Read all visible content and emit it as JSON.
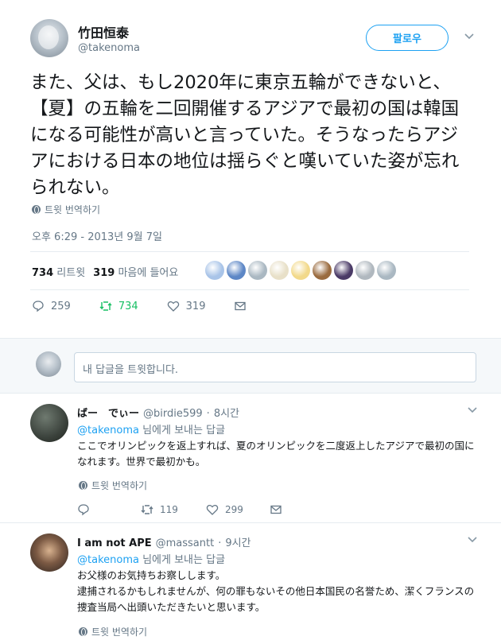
{
  "main_tweet": {
    "author_name": "竹田恒泰",
    "author_handle": "@takenoma",
    "follow_label": "팔로우",
    "text": "また、父は、もし2020年に東京五輪ができないと、【夏】の五輪を二回開催するアジアで最初の国は韓国になる可能性が高いと言っていた。そうなったらアジアにおける日本の地位は揺らぐと嘆いていた姿が忘れられない。",
    "translate_label": "트윗 번역하기",
    "timestamp": "오후 6:29 - 2013년 9월 7일",
    "retweets_count": "734",
    "retweets_label": "리트윗",
    "likes_count": "319",
    "likes_label": "마음에 들어요",
    "actions": {
      "reply_count": "259",
      "retweet_count": "734",
      "like_count": "319"
    },
    "liker_colors": [
      "#a9c4e8",
      "#5d87c6",
      "#aab8c2",
      "#e8e0c8",
      "#f2d98a",
      "#9a6b3f",
      "#4a3a66",
      "#b0b8bf",
      "#aab8c2"
    ]
  },
  "reply_box": {
    "placeholder": "내 답글을 트윗합니다."
  },
  "replies": [
    {
      "name": "ばー　でぃー",
      "handle": "@birdie599",
      "time": "8시간",
      "replying_to": "@takenoma",
      "replying_suffix": " 님에게 보내는 답글",
      "text": "ここでオリンピックを返上すれば、夏のオリンピックを二度返上したアジアで最初の国になれます。世界で最初かも。",
      "translate_label": "트윗 번역하기",
      "retweet_count": "119",
      "like_count": "299"
    },
    {
      "name": "I am not APE",
      "handle": "@massantt",
      "time": "9시간",
      "replying_to": "@takenoma",
      "replying_suffix": " 님에게 보내는 답글",
      "text": "お父様のお気持ちお察しします。\n 逮捕されるかもしれませんが、何の罪もないその他日本国民の名誉ため、潔くフランスの捜査当局へ出頭いただきたいと思います。",
      "translate_label": "트윗 번역하기"
    }
  ],
  "colors": {
    "accent": "#1da1f2",
    "retweet_active": "#17bf63",
    "muted": "#657786"
  }
}
